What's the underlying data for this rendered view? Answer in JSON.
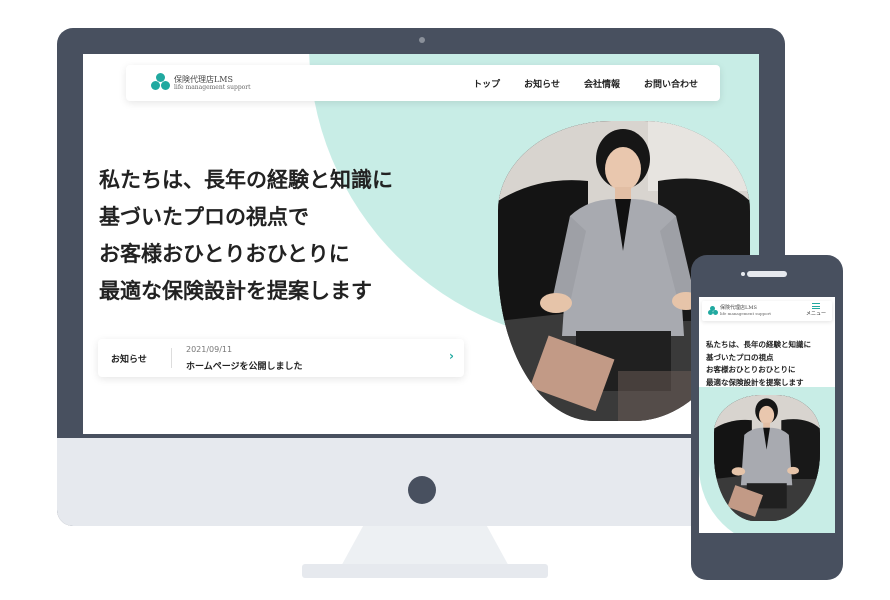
{
  "desktop": {
    "brand": {
      "name": "保険代理店LMS",
      "tagline": "life management support"
    },
    "nav": [
      {
        "label": "トップ"
      },
      {
        "label": "お知らせ"
      },
      {
        "label": "会社情報"
      },
      {
        "label": "お問い合わせ"
      }
    ],
    "hero": {
      "lines": [
        "私たちは、長年の経験と知識に",
        "基づいたプロの視点で",
        "お客様おひとりおひとりに",
        "最適な保険設計を提案します"
      ]
    },
    "news": {
      "label": "お知らせ",
      "date": "2021/09/11",
      "title": "ホームページを公開しました",
      "arrow": "›"
    }
  },
  "mobile": {
    "brand": {
      "name": "保険代理店LMS",
      "tagline": "life management support"
    },
    "menu_label": "メニュー",
    "hero": {
      "lines": [
        "私たちは、長年の経験と知識に",
        "基づいたプロの視点",
        "お客様おひとりおひとりに",
        "最適な保険設計を提案します"
      ]
    }
  },
  "colors": {
    "accent": "#21a9a0",
    "mint": "#c8ede6",
    "device_frame": "#48505f"
  }
}
